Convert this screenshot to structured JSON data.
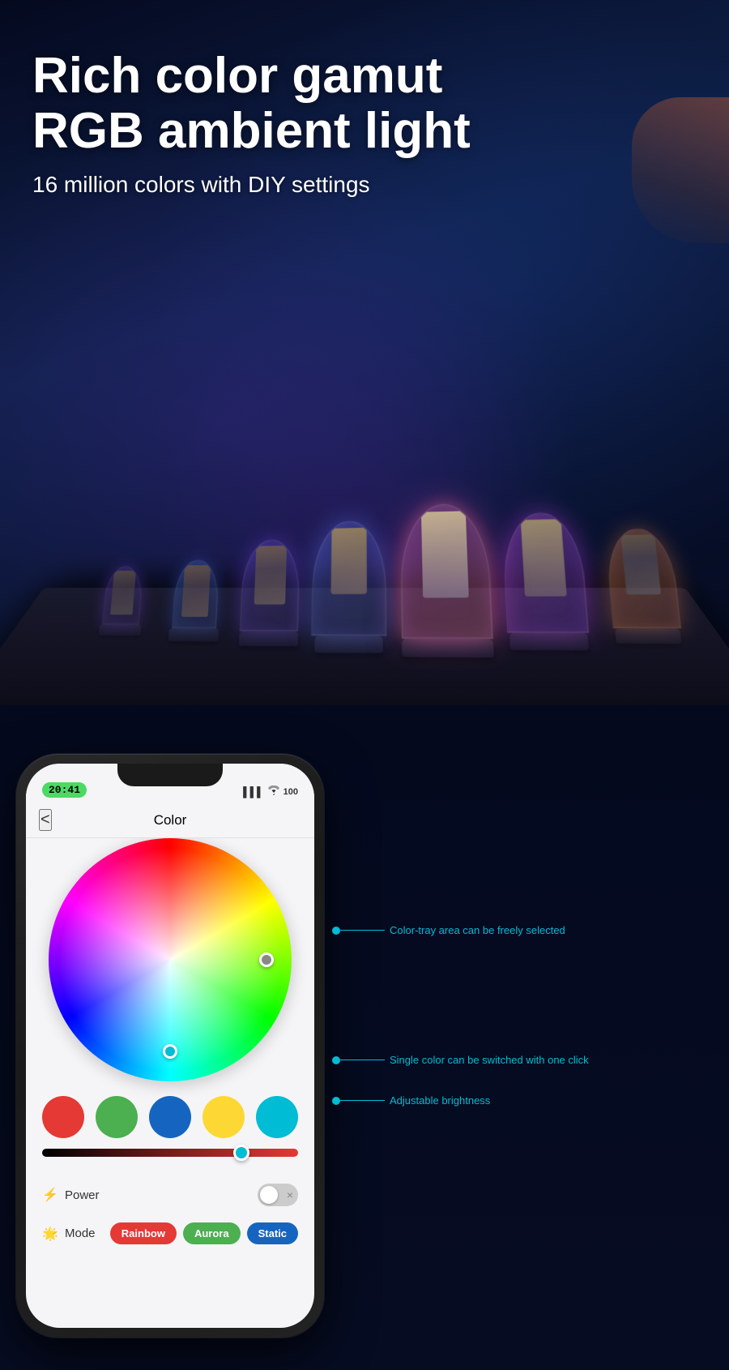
{
  "hero": {
    "title_line1": "Rich color gamut",
    "title_line2": "RGB ambient light",
    "subtitle": "16 million colors with DIY settings"
  },
  "phone": {
    "status_time": "20:41",
    "status_signal": "▌▌▌",
    "status_wifi": "WiFi",
    "status_battery": "100",
    "app_back": "<",
    "app_title": "Color",
    "power_label": "Power",
    "mode_label": "Mode",
    "mode_buttons": {
      "rainbow": "Rainbow",
      "aurora": "Aurora",
      "static": "Static"
    }
  },
  "annotations": {
    "color_tray": "Color-tray area can be freely selected",
    "single_color": "Single color can be switched with one click",
    "brightness": "Adjustable brightness"
  },
  "colors": {
    "accent_cyan": "#00bcd4",
    "mode_rainbow_bg": "#e53935",
    "mode_aurora_bg": "#4caf50",
    "mode_static_bg": "#1565c0"
  }
}
